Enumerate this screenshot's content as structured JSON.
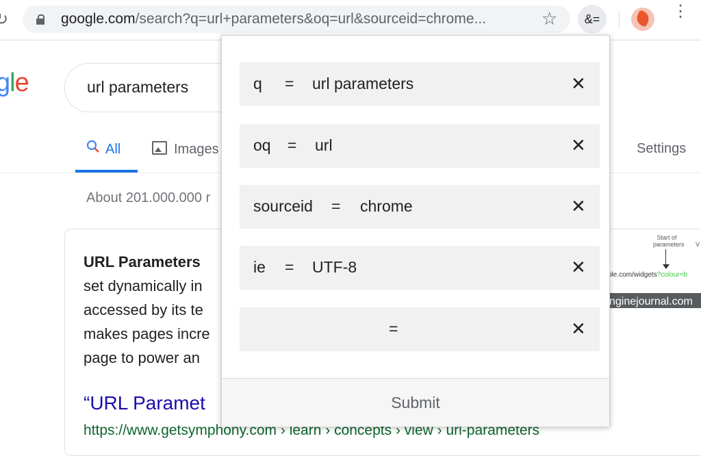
{
  "browser": {
    "url_host": "google.com",
    "url_rest": "/search?q=url+parameters&oq=url&sourceid=chrome...",
    "extension_label": "&=",
    "reload_glyph": "↻",
    "star_glyph": "☆",
    "menu_glyph": "⋮"
  },
  "google": {
    "logo_parts": [
      "g",
      "l",
      "e"
    ],
    "search_query": "url parameters",
    "tabs": {
      "all": "All",
      "images": "Images",
      "settings": "Settings"
    },
    "result_stats": "About 201.000.000 r",
    "snippet": {
      "bold": "URL Parameters",
      "lines": [
        "set dynamically in",
        "accessed by its te",
        "makes pages incre",
        "page to power an"
      ],
      "title": "“URL Paramet",
      "url": "https://www.getsymphony.com › learn › concepts › view › url-parameters",
      "image": {
        "label": "Start of parameters",
        "url_text": "ple.com/widgets",
        "url_param": "?colour=b",
        "caption": "nginejournal.com",
        "edge_letter": "V"
      }
    }
  },
  "popup": {
    "params": [
      {
        "key": "q",
        "value": "url parameters"
      },
      {
        "key": "oq",
        "value": "url"
      },
      {
        "key": "sourceid",
        "value": "chrome"
      },
      {
        "key": "ie",
        "value": "UTF-8"
      },
      {
        "key": "",
        "value": ""
      }
    ],
    "equals": "=",
    "remove_glyph": "✕",
    "submit_label": "Submit"
  },
  "colors": {
    "accent": "#1a73e8",
    "link": "#1a0dab",
    "url_green": "#0d652d",
    "row_bg": "#f1f1f1"
  }
}
